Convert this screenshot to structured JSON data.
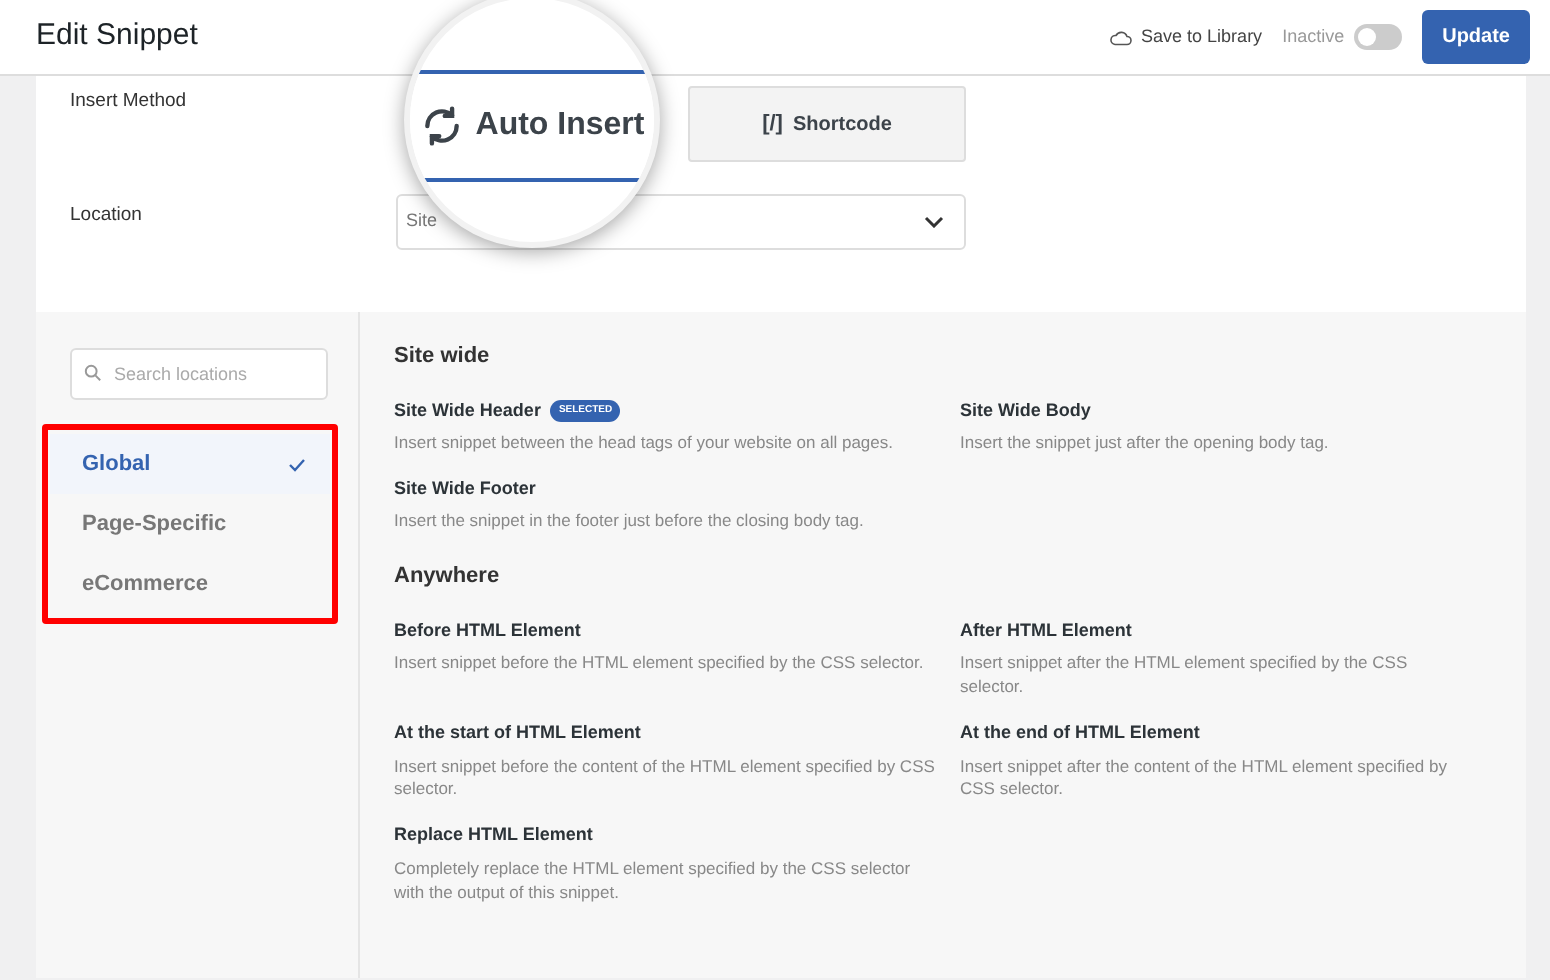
{
  "header": {
    "title": "Edit Snippet",
    "save_label": "Save to Library",
    "status_label": "Inactive",
    "active": false,
    "update_label": "Update"
  },
  "insert_method": {
    "label": "Insert Method",
    "options": [
      {
        "kind": "auto",
        "label": "Auto Insert",
        "selected": true
      },
      {
        "kind": "shortcode",
        "glyph": "[/]",
        "label": "Shortcode",
        "selected": false
      }
    ]
  },
  "location": {
    "label": "Location",
    "value": "Site"
  },
  "search": {
    "placeholder": "Search locations"
  },
  "categories": [
    {
      "label": "Global",
      "selected": true
    },
    {
      "label": "Page-Specific",
      "selected": false
    },
    {
      "label": "eCommerce",
      "selected": false
    }
  ],
  "sections": [
    {
      "title": "Site wide",
      "items": [
        {
          "title": "Site Wide Header",
          "badge": "SELECTED",
          "description": "Insert snippet between the head tags of your website on all pages."
        },
        {
          "title": "Site Wide Body",
          "description": "Insert the snippet just after the opening body tag."
        },
        {
          "title": "Site Wide Footer",
          "description": "Insert the snippet in the footer just before the closing body tag."
        }
      ]
    },
    {
      "title": "Anywhere",
      "items": [
        {
          "title": "Before HTML Element",
          "description": "Insert snippet before the HTML element specified by the CSS selector."
        },
        {
          "title": "After HTML Element",
          "description": "Insert snippet after the HTML element specified by the CSS selector."
        },
        {
          "title": "At the start of HTML Element",
          "description": "Insert snippet before the content of the HTML element specified by CSS selector."
        },
        {
          "title": "At the end of HTML Element",
          "description": "Insert snippet after the content of the HTML element specified by CSS selector."
        },
        {
          "title": "Replace HTML Element",
          "description": "Completely replace the HTML element specified by the CSS selector with the output of this snippet."
        }
      ]
    }
  ]
}
